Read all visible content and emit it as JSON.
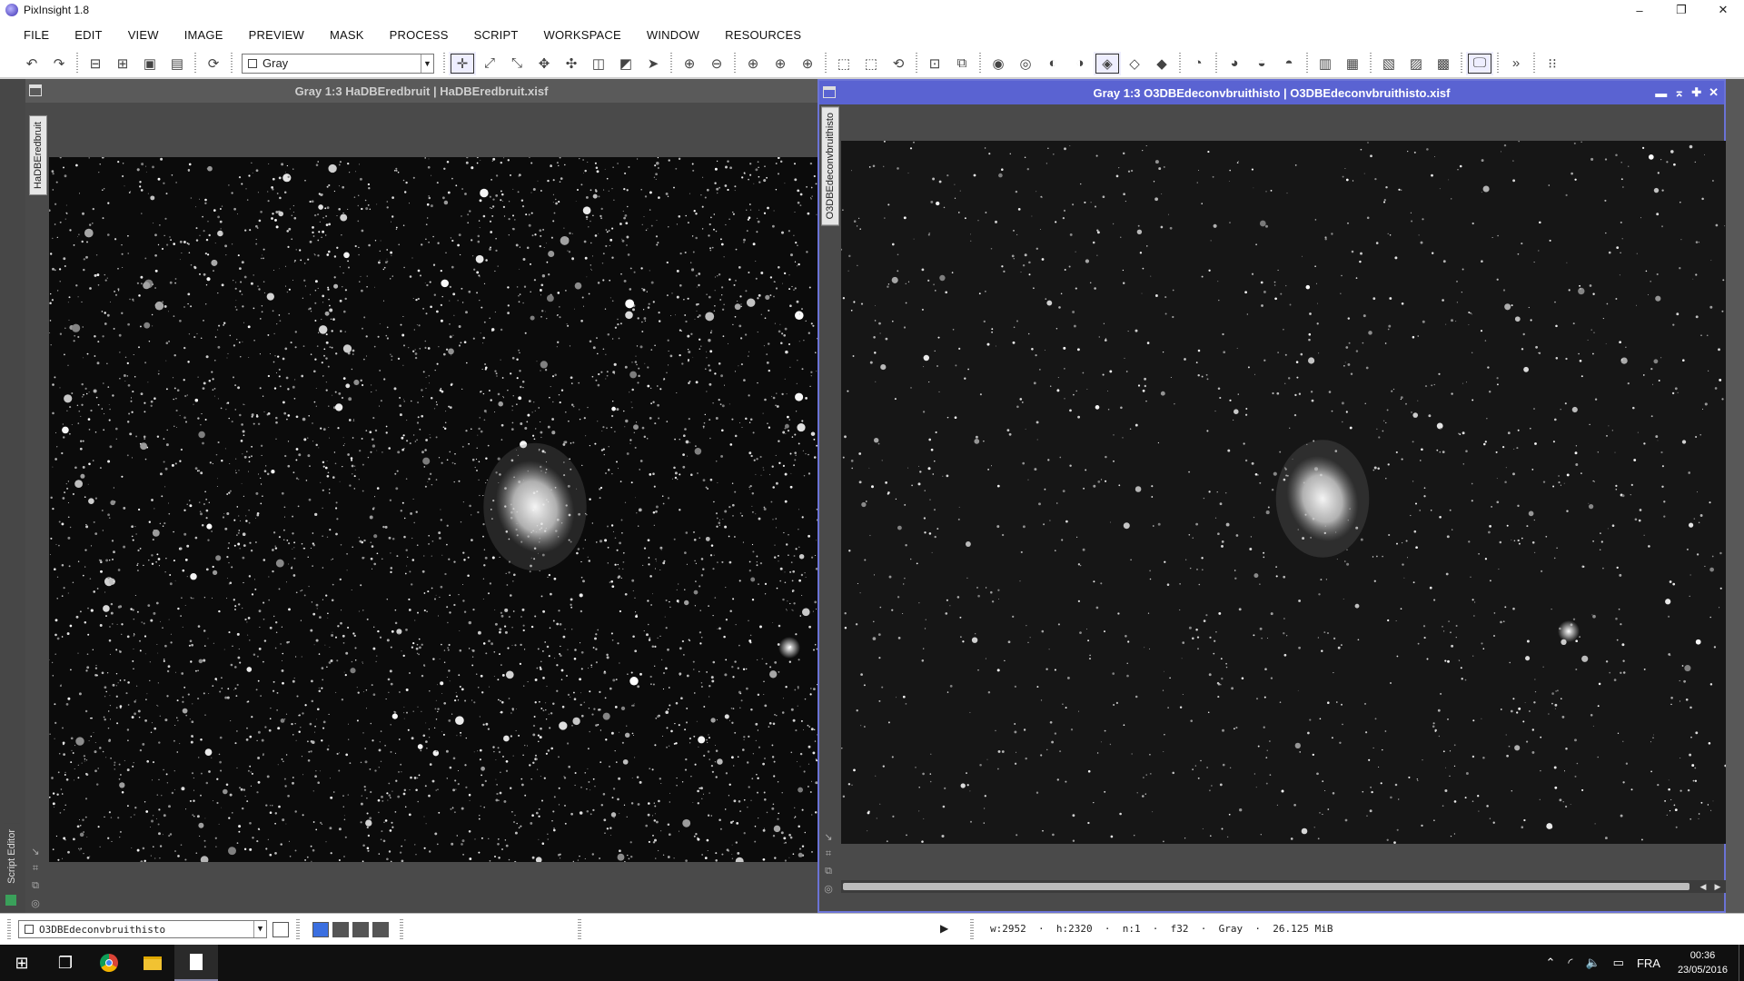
{
  "app": {
    "title": "PixInsight 1.8"
  },
  "window_controls": {
    "minimize": "–",
    "restore": "❐",
    "close": "✕"
  },
  "menu": [
    "FILE",
    "EDIT",
    "VIEW",
    "IMAGE",
    "PREVIEW",
    "MASK",
    "PROCESS",
    "SCRIPT",
    "WORKSPACE",
    "WINDOW",
    "RESOURCES"
  ],
  "toolbar": {
    "colorspace_value": "Gray",
    "overflow": "»"
  },
  "left_strip": {
    "script_editor_label": "Script Editor"
  },
  "views": {
    "left": {
      "title": "Gray 1:3 HaDBEredbruit | HaDBEredbruit.xisf",
      "tab_label": "HaDBEredbruit"
    },
    "right": {
      "title": "Gray 1:3 O3DBEdeconvbruithisto | O3DBEdeconvbruithisto.xisf",
      "tab_label": "O3DBEdeconvbruithisto"
    }
  },
  "statusbar": {
    "active_view": "O3DBEdeconvbruithisto",
    "image_info": "w:2952  ·  h:2320  ·  n:1  ·  f32  ·  Gray  ·  26.125 MiB"
  },
  "taskbar": {
    "language": "FRA",
    "time": "00:36",
    "date": "23/05/2016"
  }
}
